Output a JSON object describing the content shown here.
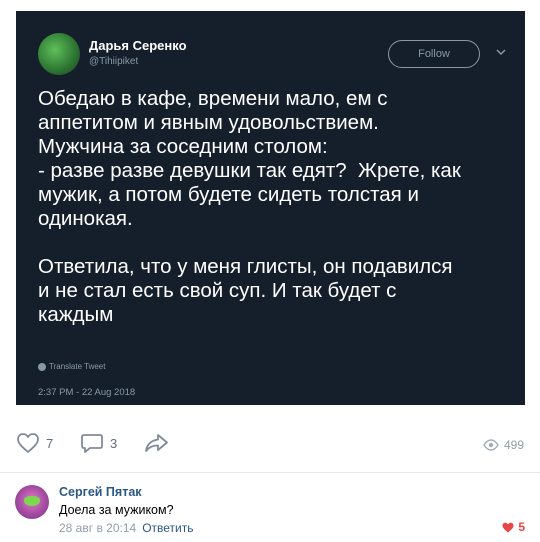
{
  "tweet": {
    "author_name": "Дарья Серенко",
    "author_handle": "@Tihiipiket",
    "follow_label": "Follow",
    "text": "Обедаю в кафе, времени мало, ем с\nаппетитом и явным удовольствием.\nМужчина за соседним столом:\n- разве разве девушки так едят?  Жрете, как\nмужик, а потом будете сидеть толстая и\nодинокая.\n\nОтветила, что у меня глисты, он подавился\nи не стал есть свой суп. И так будет с\nкаждым",
    "translate_label": "Translate Tweet",
    "timestamp": "2:37 PM - 22 Aug 2018",
    "colors": {
      "background": "#151f2b",
      "text": "#ffffff",
      "muted": "#8899a6"
    }
  },
  "actions": {
    "likes": "7",
    "comments": "3",
    "views": "499",
    "icons": {
      "like": "heart-outline-icon",
      "comment": "comment-icon",
      "share": "share-arrow-icon",
      "views": "eye-icon"
    }
  },
  "comment": {
    "author": "Сергей Пятак",
    "text": "Доела за мужиком?",
    "date": "28 авг в 20:14",
    "reply_label": "Ответить",
    "likes": "5",
    "colors": {
      "link": "#2a5885",
      "like": "#e64646"
    }
  }
}
